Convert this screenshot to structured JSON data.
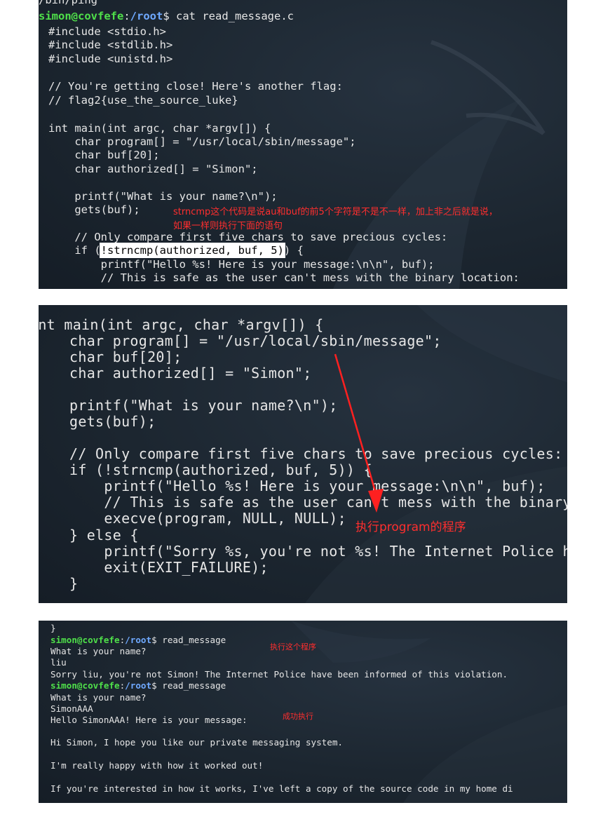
{
  "panel1": {
    "lines": [
      "/bin/ping",
      "",
      "#include <stdio.h>",
      "#include <stdlib.h>",
      "#include <unistd.h>",
      "",
      "// You're getting close! Here's another flag:",
      "// flag2{use_the_source_luke}",
      "",
      "int main(int argc, char *argv[]) {",
      "    char program[] = \"/usr/local/sbin/message\";",
      "    char buf[20];",
      "    char authorized[] = \"Simon\";",
      "",
      "    printf(\"What is your name?\\n\");",
      "    gets(buf);",
      "",
      "    // Only compare first five chars to save precious cycles:",
      "",
      "        printf(\"Hello %s! Here is your message:\\n\\n\", buf);",
      "        // This is safe as the user can't mess with the binary location:"
    ],
    "prompt": {
      "user": "simon@covfefe",
      "colon": ":",
      "path": "/root",
      "cmd": "$ cat read_message.c"
    },
    "if_line": {
      "before": "    if (",
      "highlight": "!strncmp(authorized, buf, 5)",
      "after": ") {"
    },
    "annotation_line1": "strncmp这个代码是说au和buf的前5个字符是不是不一样，加上非之后就是说，",
    "annotation_line2": "如果一样则执行下面的语句"
  },
  "panel2": {
    "lines": [
      "int main(int argc, char *argv[]) {",
      "   char program[] = \"/usr/local/sbin/message\";",
      "   char buf[20];",
      "   char authorized[] = \"Simon\";",
      "",
      "   printf(\"What is your name?\\n\");",
      "   gets(buf);",
      "",
      "   // Only compare first five chars to save precious cycles:",
      "   if (!strncmp(authorized, buf, 5)) {",
      "       printf(\"Hello %s! Here is your message:\\n\\n\", buf);",
      "       // This is safe as the user can't mess with the binary",
      "       execve(program, NULL, NULL);",
      "   } else {",
      "       printf(\"Sorry %s, you're not %s! The Internet Police ha",
      "       exit(EXIT_FAILURE);",
      "   }"
    ],
    "annotation": "执行program的程序",
    "arrow_color": "#ff2020"
  },
  "panel3": {
    "lines": [
      "}",
      "",
      "What is your name?",
      "liu",
      "Sorry liu, you're not Simon! The Internet Police have been informed of this violation.",
      "",
      "What is your name?",
      "SimonAAA",
      "Hello SimonAAA! Here is your message:",
      "",
      "Hi Simon, I hope you like our private messaging system.",
      "",
      "I'm really happy with how it worked out!",
      "",
      "If you're interested in how it works, I've left a copy of the source code in my home di"
    ],
    "prompt1": {
      "user": "simon@covfefe",
      "colon": ":",
      "path": "/root",
      "cmd": "$ read_message"
    },
    "prompt2": {
      "user": "simon@covfefe",
      "colon": ":",
      "path": "/root",
      "cmd": "$ read_message"
    },
    "annotation1": "执行这个程序",
    "annotation2": "成功执行"
  },
  "colors": {
    "terminal_bg": "#1e2a35",
    "text": "#e6e6e6",
    "prompt_user": "#4fe04a",
    "prompt_path": "#6fa9ff",
    "annotation": "#ff2e2e"
  }
}
